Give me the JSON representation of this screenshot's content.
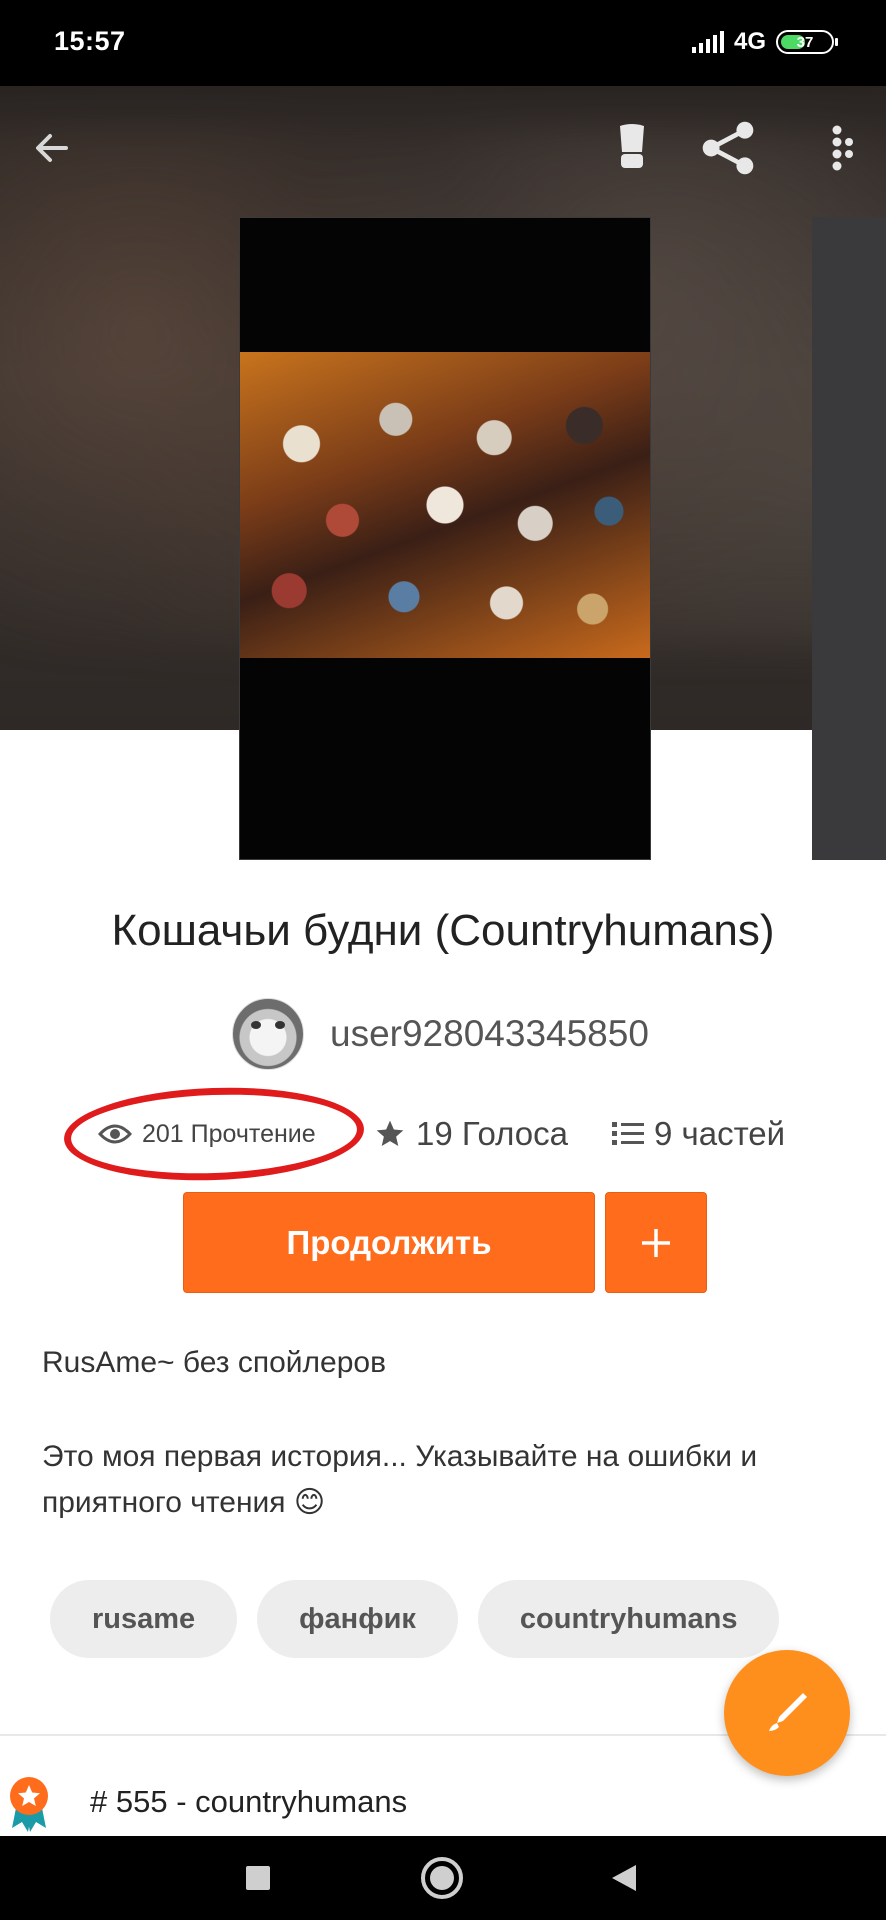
{
  "status_bar": {
    "time": "15:57",
    "network": "4G",
    "battery": "37"
  },
  "toolbar": {
    "back_icon": "arrow-left-icon",
    "light_icon": "shaving-brush-icon",
    "share_icon": "share-icon",
    "menu_icon": "more-vertical-icon"
  },
  "story": {
    "title": "Кошачьи будни (Countryhumans)",
    "author": "user928043345850",
    "stats": {
      "reads": "201 Прочтение",
      "votes": "19 Голоса",
      "parts": "9 частей"
    },
    "continue_label": "Продолжить",
    "add_label": "+",
    "description": [
      "RusAme~  без спойлеров",
      "Это моя первая история...  Указывайте на ошибки и приятного чтения 😊"
    ],
    "tags": [
      "rusame",
      "фанфик",
      "countryhumans"
    ],
    "rank": "# 555 - countryhumans"
  },
  "colors": {
    "accent": "#ff6c1c",
    "fab": "#ff8f1c",
    "annotation": "#e01b1b"
  }
}
